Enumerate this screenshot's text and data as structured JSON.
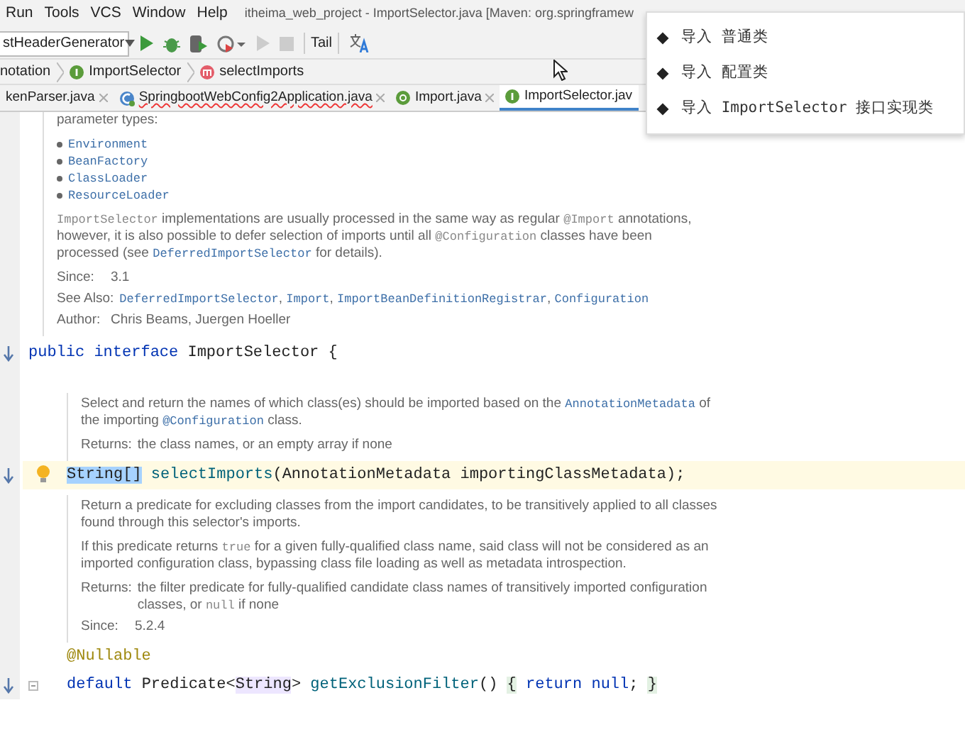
{
  "menu": [
    {
      "label": "Run"
    },
    {
      "label": "Tools"
    },
    {
      "label": "VCS"
    },
    {
      "label": "Window"
    },
    {
      "label": "Help"
    }
  ],
  "window": {
    "title": "itheima_web_project - ImportSelector.java [Maven: org.springframew"
  },
  "toolbar": {
    "run_config": "stHeaderGenerator",
    "tail": "Tail"
  },
  "breadcrumb": [
    {
      "label": "notation",
      "kind": "plain"
    },
    {
      "label": "ImportSelector",
      "kind": "interface"
    },
    {
      "label": "selectImports",
      "kind": "method"
    }
  ],
  "tabs": [
    {
      "label": "kenParser.java",
      "kind": "plain",
      "selected": false,
      "error": false
    },
    {
      "label": "SpringbootWebConfig2Application.java",
      "kind": "spring",
      "selected": false,
      "error": true
    },
    {
      "label": "Import.java",
      "kind": "annotation",
      "selected": false,
      "error": false
    },
    {
      "label": "ImportSelector.jav",
      "kind": "interface",
      "selected": true,
      "error": false
    }
  ],
  "editor": [
    {
      "kind": "doc",
      "indent": false,
      "items": [
        {
          "kind": "para",
          "segments": [
            {
              "kind": "text",
              "t": "parameter types:"
            }
          ]
        },
        {
          "kind": "list",
          "items": [
            "Environment",
            "BeanFactory",
            "ClassLoader",
            "ResourceLoader"
          ]
        },
        {
          "kind": "para",
          "segments": [
            {
              "kind": "code",
              "t": "ImportSelector"
            },
            {
              "kind": "text",
              "t": " implementations are usually processed in the same way as regular "
            },
            {
              "kind": "code",
              "t": "@Import"
            },
            {
              "kind": "text",
              "t": " annotations, however, it is also possible to defer selection of imports until all "
            },
            {
              "kind": "code",
              "t": "@Configuration"
            },
            {
              "kind": "text",
              "t": " classes have been processed (see "
            },
            {
              "kind": "link",
              "t": "DeferredImportSelector"
            },
            {
              "kind": "text",
              "t": " for details)."
            }
          ]
        },
        {
          "kind": "field",
          "label": "Since:",
          "segments": [
            {
              "kind": "text",
              "t": "3.1"
            }
          ]
        },
        {
          "kind": "field",
          "label": "See Also:",
          "segments": [
            {
              "kind": "link",
              "t": "DeferredImportSelector"
            },
            {
              "kind": "text",
              "t": ", "
            },
            {
              "kind": "link",
              "t": "Import"
            },
            {
              "kind": "text",
              "t": ", "
            },
            {
              "kind": "link",
              "t": "ImportBeanDefinitionRegistrar"
            },
            {
              "kind": "text",
              "t": ", "
            },
            {
              "kind": "link",
              "t": "Configuration"
            }
          ]
        },
        {
          "kind": "field",
          "label": "Author:",
          "segments": [
            {
              "kind": "text",
              "t": "Chris Beams, Juergen Hoeller"
            }
          ]
        }
      ]
    },
    {
      "kind": "code",
      "current": false,
      "marker": true,
      "fold": false,
      "indent": false,
      "tokens": [
        {
          "kind": "keyword",
          "t": "public interface"
        },
        {
          "kind": "plain",
          "t": " ImportSelector {"
        }
      ]
    },
    {
      "kind": "doc",
      "indent": true,
      "items": [
        {
          "kind": "para",
          "segments": [
            {
              "kind": "text",
              "t": "Select and return the names of which class(es) should be imported based on the "
            },
            {
              "kind": "link",
              "t": "AnnotationMetadata"
            },
            {
              "kind": "text",
              "t": " of the importing "
            },
            {
              "kind": "link",
              "t": "@Configuration"
            },
            {
              "kind": "text",
              "t": " class."
            }
          ]
        },
        {
          "kind": "field",
          "label": "Returns:",
          "segments": [
            {
              "kind": "text",
              "t": "the class names, or an empty array if none"
            }
          ]
        }
      ]
    },
    {
      "kind": "code",
      "current": true,
      "marker": true,
      "fold": false,
      "indent": true,
      "tokens": [
        {
          "kind": "selected",
          "t": "String[]"
        },
        {
          "kind": "method",
          "t": " selectImports"
        },
        {
          "kind": "plain",
          "t": "(AnnotationMetadata importingClassMetadata);"
        }
      ]
    },
    {
      "kind": "doc",
      "indent": true,
      "items": [
        {
          "kind": "para",
          "segments": [
            {
              "kind": "text",
              "t": "Return a predicate for excluding classes from the import candidates, to be transitively applied to all classes found through this selector's imports."
            }
          ]
        },
        {
          "kind": "para",
          "segments": [
            {
              "kind": "text",
              "t": "If this predicate returns "
            },
            {
              "kind": "code",
              "t": "true"
            },
            {
              "kind": "text",
              "t": " for a given fully-qualified class name, said class will not be considered as an imported configuration class, bypassing class file loading as well as metadata introspection."
            }
          ]
        },
        {
          "kind": "field",
          "label": "Returns:",
          "segments": [
            {
              "kind": "text",
              "t": "the filter predicate for fully-qualified candidate class names of transitively imported configuration classes, or "
            },
            {
              "kind": "code",
              "t": "null"
            },
            {
              "kind": "text",
              "t": " if none"
            }
          ]
        },
        {
          "kind": "field",
          "label": "Since:",
          "segments": [
            {
              "kind": "text",
              "t": "5.2.4"
            }
          ]
        }
      ]
    },
    {
      "kind": "code",
      "current": false,
      "marker": false,
      "fold": false,
      "indent": true,
      "tokens": [
        {
          "kind": "annotation",
          "t": "@Nullable"
        }
      ]
    },
    {
      "kind": "code",
      "current": false,
      "marker": true,
      "fold": true,
      "indent": true,
      "tokens": [
        {
          "kind": "keyword",
          "t": "default"
        },
        {
          "kind": "plain",
          "t": " Predicate<"
        },
        {
          "kind": "usage",
          "t": "String"
        },
        {
          "kind": "plain",
          "t": ">"
        },
        {
          "kind": "method",
          "t": " getExclusionFilter"
        },
        {
          "kind": "plain",
          "t": "() "
        },
        {
          "kind": "brace",
          "t": "{"
        },
        {
          "kind": "keyword",
          "t": " return null"
        },
        {
          "kind": "plain",
          "t": "; "
        },
        {
          "kind": "brace",
          "t": "}"
        }
      ]
    }
  ],
  "popup": {
    "items": [
      "导入 普通类",
      "导入 配置类",
      "导入 ImportSelector 接口实现类"
    ]
  }
}
